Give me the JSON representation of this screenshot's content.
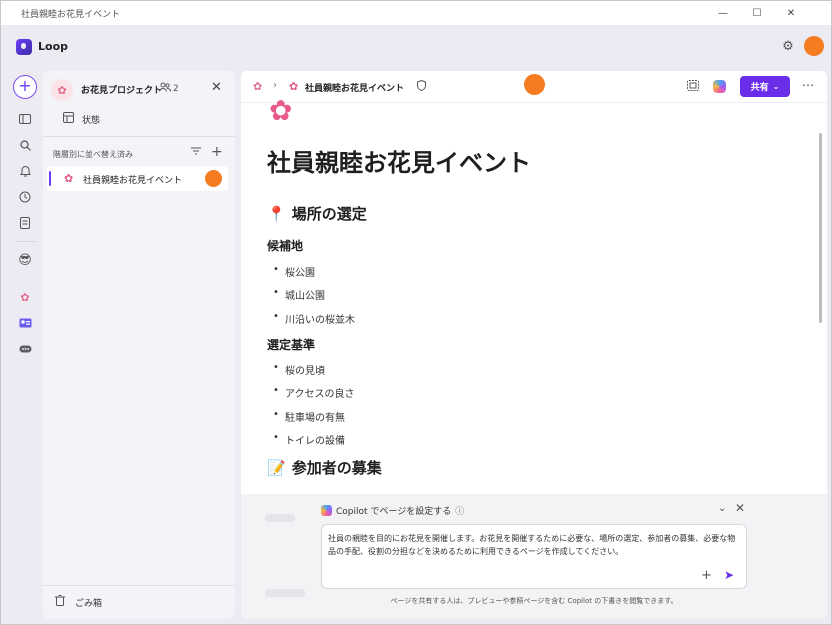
{
  "window": {
    "title": "社員親睦お花見イベント",
    "controls": {
      "minimize": "—",
      "maximize": "☐",
      "close": "✕"
    }
  },
  "app": {
    "name": "Loop"
  },
  "sidebar": {
    "workspace_name": "お花見プロジェクト",
    "member_count": "2",
    "status_label": "状態",
    "sort_label": "階層別に並べ替え済み",
    "pages": [
      {
        "label": "社員親睦お花見イベント"
      }
    ],
    "trash_label": "ごみ箱"
  },
  "toolbar": {
    "breadcrumb_title": "社員親睦お花見イベント",
    "share_label": "共有"
  },
  "page": {
    "title": "社員親睦お花見イベント",
    "section1": {
      "heading": "場所の選定",
      "sub1": {
        "heading": "候補地",
        "items": [
          "桜公園",
          "城山公園",
          "川沿いの桜並木"
        ]
      },
      "sub2": {
        "heading": "選定基準",
        "items": [
          "桜の見頃",
          "アクセスの良さ",
          "駐車場の有無",
          "トイレの設備"
        ]
      }
    },
    "section2": {
      "heading": "参加者の募集"
    }
  },
  "copilot": {
    "header": "Copilot でページを設定する",
    "prompt": "社員の親睦を目的にお花見を開催します。お花見を開催するために必要な、場所の選定、参加者の募集、必要な物品の手配、役割の分担などを決めるために利用できるページを作成してください。",
    "footer": "ページを共有する人は、プレビューや参照ページを含む Copilot の下書きを閲覧できます。"
  },
  "colors": {
    "accent": "#6b2ee8",
    "avatar": "#f57c20",
    "sakura": "#e85a8a"
  }
}
